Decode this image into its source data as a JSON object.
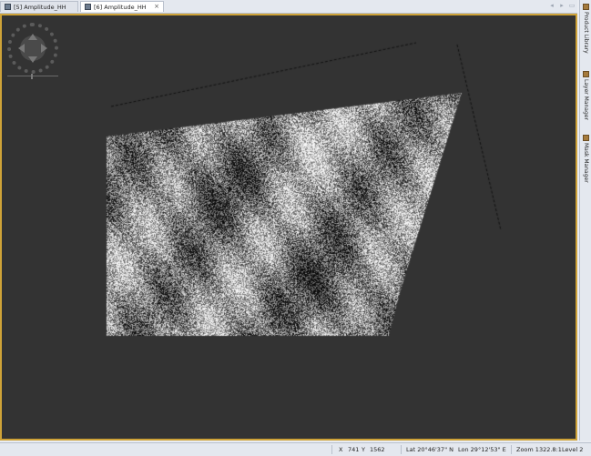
{
  "tabs": [
    {
      "label": "[5] Amplitude_HH",
      "active": false
    },
    {
      "label": "[6] Amplitude_HH",
      "active": true
    }
  ],
  "side_panel": [
    {
      "label": "Product Library",
      "icon": "product-library-icon"
    },
    {
      "label": "Layer Manager",
      "icon": "layer-manager-icon"
    },
    {
      "label": "Mask Manager",
      "icon": "mask-manager-icon"
    }
  ],
  "status": {
    "x_label": "X",
    "x_value": "741",
    "y_label": "Y",
    "y_value": "1562",
    "lat": "Lat 20°46'37\" N",
    "lon": "Lon 29°12'53\" E",
    "zoom": "Zoom 1322.8:1",
    "level": "Level 2"
  },
  "colors": {
    "canvas_bg": "#333333",
    "viewport_border": "#cfa338",
    "chrome_bg": "#e4e8ef"
  },
  "icons": {
    "navigation": "navigation-control-icon",
    "tab": "image-view-icon"
  }
}
